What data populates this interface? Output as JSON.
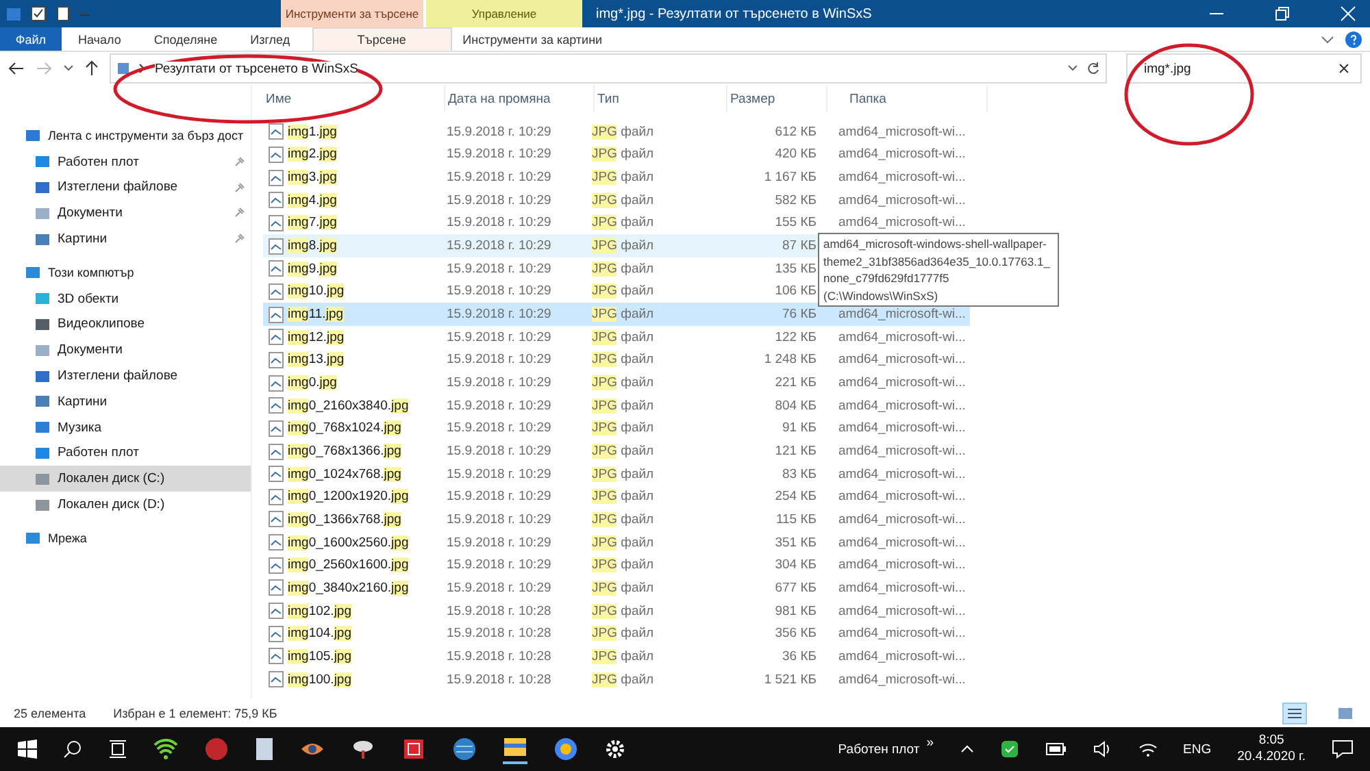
{
  "window": {
    "title": "img*.jpg - Резултати от търсенето в WinSxS",
    "context_groups": [
      {
        "label": "Инструменти за търсене",
        "kind": "search"
      },
      {
        "label": "Управление",
        "kind": "manage"
      }
    ]
  },
  "ribbon_tabs": [
    {
      "label": "Файл",
      "kind": "file",
      "selected": false
    },
    {
      "label": "Начало",
      "kind": "plain",
      "selected": false
    },
    {
      "label": "Споделяне",
      "kind": "plain",
      "selected": false
    },
    {
      "label": "Изглед",
      "kind": "plain",
      "selected": false
    },
    {
      "label": "Търсене",
      "kind": "search",
      "selected": true
    },
    {
      "label": "Инструменти за картини",
      "kind": "manage",
      "selected": false
    }
  ],
  "address": {
    "path": "Резултати от търсенето в WinSxS",
    "search_value": "img*.jpg"
  },
  "sidebar": [
    {
      "label": "Лента с инструменти за бърз дост",
      "selected": false,
      "children": [
        {
          "label": "Работен плот",
          "pinned": true,
          "selected": false
        },
        {
          "label": "Изтеглени файлове",
          "pinned": true,
          "selected": false
        },
        {
          "label": "Документи",
          "pinned": true,
          "selected": false
        },
        {
          "label": "Картини",
          "pinned": true,
          "selected": false
        }
      ]
    },
    {
      "label": "Този компютър",
      "selected": false,
      "children": [
        {
          "label": "3D обекти",
          "pinned": false,
          "selected": false
        },
        {
          "label": "Видеоклипове",
          "pinned": false,
          "selected": false
        },
        {
          "label": "Документи",
          "pinned": false,
          "selected": false
        },
        {
          "label": "Изтеглени файлове",
          "pinned": false,
          "selected": false
        },
        {
          "label": "Картини",
          "pinned": false,
          "selected": false
        },
        {
          "label": "Музика",
          "pinned": false,
          "selected": false
        },
        {
          "label": "Работен плот",
          "pinned": false,
          "selected": false
        },
        {
          "label": "Локален диск (C:)",
          "pinned": false,
          "selected": true
        },
        {
          "label": "Локален диск (D:)",
          "pinned": false,
          "selected": false
        }
      ]
    },
    {
      "label": "Мрежа",
      "selected": false
    }
  ],
  "table": {
    "columns": [
      "Име",
      "Дата на промяна",
      "Тип",
      "Размер",
      "Папка"
    ],
    "rows": [
      {
        "name": [
          {
            "text": "img",
            "hl": true
          },
          {
            "text": "1.",
            "hl": false
          },
          {
            "text": "jpg",
            "hl": true
          }
        ],
        "date": "15.9.2018 г. 10:29",
        "type": [
          {
            "text": "JPG",
            "hl": true
          },
          {
            "text": " файл",
            "hl": false
          }
        ],
        "size": "612 КБ",
        "folder": "amd64_microsoft-wi...",
        "hovered": false,
        "selected": false
      },
      {
        "name": [
          {
            "text": "img",
            "hl": true
          },
          {
            "text": "2.",
            "hl": false
          },
          {
            "text": "jpg",
            "hl": true
          }
        ],
        "date": "15.9.2018 г. 10:29",
        "type": [
          {
            "text": "JPG",
            "hl": true
          },
          {
            "text": " файл",
            "hl": false
          }
        ],
        "size": "420 КБ",
        "folder": "amd64_microsoft-wi...",
        "hovered": false,
        "selected": false
      },
      {
        "name": [
          {
            "text": "img",
            "hl": true
          },
          {
            "text": "3.",
            "hl": false
          },
          {
            "text": "jpg",
            "hl": true
          }
        ],
        "date": "15.9.2018 г. 10:29",
        "type": [
          {
            "text": "JPG",
            "hl": true
          },
          {
            "text": " файл",
            "hl": false
          }
        ],
        "size": "1 167 КБ",
        "folder": "amd64_microsoft-wi...",
        "hovered": false,
        "selected": false
      },
      {
        "name": [
          {
            "text": "img",
            "hl": true
          },
          {
            "text": "4.",
            "hl": false
          },
          {
            "text": "jpg",
            "hl": true
          }
        ],
        "date": "15.9.2018 г. 10:29",
        "type": [
          {
            "text": "JPG",
            "hl": true
          },
          {
            "text": " файл",
            "hl": false
          }
        ],
        "size": "582 КБ",
        "folder": "amd64_microsoft-wi...",
        "hovered": false,
        "selected": false
      },
      {
        "name": [
          {
            "text": "img",
            "hl": true
          },
          {
            "text": "7.",
            "hl": false
          },
          {
            "text": "jpg",
            "hl": true
          }
        ],
        "date": "15.9.2018 г. 10:29",
        "type": [
          {
            "text": "JPG",
            "hl": true
          },
          {
            "text": " файл",
            "hl": false
          }
        ],
        "size": "155 КБ",
        "folder": "amd64_microsoft-wi...",
        "hovered": false,
        "selected": false
      },
      {
        "name": [
          {
            "text": "img",
            "hl": true
          },
          {
            "text": "8.",
            "hl": false
          },
          {
            "text": "jpg",
            "hl": true
          }
        ],
        "date": "15.9.2018 г. 10:29",
        "type": [
          {
            "text": "JPG",
            "hl": true
          },
          {
            "text": " файл",
            "hl": false
          }
        ],
        "size": "87 КБ",
        "folder": "",
        "hovered": true,
        "selected": false
      },
      {
        "name": [
          {
            "text": "img",
            "hl": true
          },
          {
            "text": "9.",
            "hl": false
          },
          {
            "text": "jpg",
            "hl": true
          }
        ],
        "date": "15.9.2018 г. 10:29",
        "type": [
          {
            "text": "JPG",
            "hl": true
          },
          {
            "text": " файл",
            "hl": false
          }
        ],
        "size": "135 КБ",
        "folder": "",
        "hovered": false,
        "selected": false
      },
      {
        "name": [
          {
            "text": "img",
            "hl": true
          },
          {
            "text": "10.",
            "hl": false
          },
          {
            "text": "jpg",
            "hl": true
          }
        ],
        "date": "15.9.2018 г. 10:29",
        "type": [
          {
            "text": "JPG",
            "hl": true
          },
          {
            "text": " файл",
            "hl": false
          }
        ],
        "size": "106 КБ",
        "folder": "",
        "hovered": false,
        "selected": false
      },
      {
        "name": [
          {
            "text": "img",
            "hl": true
          },
          {
            "text": "11.",
            "hl": false
          },
          {
            "text": "jpg",
            "hl": true
          }
        ],
        "date": "15.9.2018 г. 10:29",
        "type": [
          {
            "text": "JPG",
            "hl": true
          },
          {
            "text": " файл",
            "hl": false
          }
        ],
        "size": "76 КБ",
        "folder": "amd64_microsoft-wi...",
        "hovered": false,
        "selected": true
      },
      {
        "name": [
          {
            "text": "img",
            "hl": true
          },
          {
            "text": "12.",
            "hl": false
          },
          {
            "text": "jpg",
            "hl": true
          }
        ],
        "date": "15.9.2018 г. 10:29",
        "type": [
          {
            "text": "JPG",
            "hl": true
          },
          {
            "text": " файл",
            "hl": false
          }
        ],
        "size": "122 КБ",
        "folder": "amd64_microsoft-wi...",
        "hovered": false,
        "selected": false
      },
      {
        "name": [
          {
            "text": "img",
            "hl": true
          },
          {
            "text": "13.",
            "hl": false
          },
          {
            "text": "jpg",
            "hl": true
          }
        ],
        "date": "15.9.2018 г. 10:29",
        "type": [
          {
            "text": "JPG",
            "hl": true
          },
          {
            "text": " файл",
            "hl": false
          }
        ],
        "size": "1 248 КБ",
        "folder": "amd64_microsoft-wi...",
        "hovered": false,
        "selected": false
      },
      {
        "name": [
          {
            "text": "img",
            "hl": true
          },
          {
            "text": "0.",
            "hl": false
          },
          {
            "text": "jpg",
            "hl": true
          }
        ],
        "date": "15.9.2018 г. 10:29",
        "type": [
          {
            "text": "JPG",
            "hl": true
          },
          {
            "text": " файл",
            "hl": false
          }
        ],
        "size": "221 КБ",
        "folder": "amd64_microsoft-wi...",
        "hovered": false,
        "selected": false
      },
      {
        "name": [
          {
            "text": "img",
            "hl": true
          },
          {
            "text": "0_2160x3840.",
            "hl": false
          },
          {
            "text": "jpg",
            "hl": true
          }
        ],
        "date": "15.9.2018 г. 10:29",
        "type": [
          {
            "text": "JPG",
            "hl": true
          },
          {
            "text": " файл",
            "hl": false
          }
        ],
        "size": "804 КБ",
        "folder": "amd64_microsoft-wi...",
        "hovered": false,
        "selected": false
      },
      {
        "name": [
          {
            "text": "img",
            "hl": true
          },
          {
            "text": "0_768x1024.",
            "hl": false
          },
          {
            "text": "jpg",
            "hl": true
          }
        ],
        "date": "15.9.2018 г. 10:29",
        "type": [
          {
            "text": "JPG",
            "hl": true
          },
          {
            "text": " файл",
            "hl": false
          }
        ],
        "size": "91 КБ",
        "folder": "amd64_microsoft-wi...",
        "hovered": false,
        "selected": false
      },
      {
        "name": [
          {
            "text": "img",
            "hl": true
          },
          {
            "text": "0_768x1366.",
            "hl": false
          },
          {
            "text": "jpg",
            "hl": true
          }
        ],
        "date": "15.9.2018 г. 10:29",
        "type": [
          {
            "text": "JPG",
            "hl": true
          },
          {
            "text": " файл",
            "hl": false
          }
        ],
        "size": "121 КБ",
        "folder": "amd64_microsoft-wi...",
        "hovered": false,
        "selected": false
      },
      {
        "name": [
          {
            "text": "img",
            "hl": true
          },
          {
            "text": "0_1024x768.",
            "hl": false
          },
          {
            "text": "jpg",
            "hl": true
          }
        ],
        "date": "15.9.2018 г. 10:29",
        "type": [
          {
            "text": "JPG",
            "hl": true
          },
          {
            "text": " файл",
            "hl": false
          }
        ],
        "size": "83 КБ",
        "folder": "amd64_microsoft-wi...",
        "hovered": false,
        "selected": false
      },
      {
        "name": [
          {
            "text": "img",
            "hl": true
          },
          {
            "text": "0_1200x1920.",
            "hl": false
          },
          {
            "text": "jpg",
            "hl": true
          }
        ],
        "date": "15.9.2018 г. 10:29",
        "type": [
          {
            "text": "JPG",
            "hl": true
          },
          {
            "text": " файл",
            "hl": false
          }
        ],
        "size": "254 КБ",
        "folder": "amd64_microsoft-wi...",
        "hovered": false,
        "selected": false
      },
      {
        "name": [
          {
            "text": "img",
            "hl": true
          },
          {
            "text": "0_1366x768.",
            "hl": false
          },
          {
            "text": "jpg",
            "hl": true
          }
        ],
        "date": "15.9.2018 г. 10:29",
        "type": [
          {
            "text": "JPG",
            "hl": true
          },
          {
            "text": " файл",
            "hl": false
          }
        ],
        "size": "115 КБ",
        "folder": "amd64_microsoft-wi...",
        "hovered": false,
        "selected": false
      },
      {
        "name": [
          {
            "text": "img",
            "hl": true
          },
          {
            "text": "0_1600x2560.",
            "hl": false
          },
          {
            "text": "jpg",
            "hl": true
          }
        ],
        "date": "15.9.2018 г. 10:29",
        "type": [
          {
            "text": "JPG",
            "hl": true
          },
          {
            "text": " файл",
            "hl": false
          }
        ],
        "size": "351 КБ",
        "folder": "amd64_microsoft-wi...",
        "hovered": false,
        "selected": false
      },
      {
        "name": [
          {
            "text": "img",
            "hl": true
          },
          {
            "text": "0_2560x1600.",
            "hl": false
          },
          {
            "text": "jpg",
            "hl": true
          }
        ],
        "date": "15.9.2018 г. 10:29",
        "type": [
          {
            "text": "JPG",
            "hl": true
          },
          {
            "text": " файл",
            "hl": false
          }
        ],
        "size": "304 КБ",
        "folder": "amd64_microsoft-wi...",
        "hovered": false,
        "selected": false
      },
      {
        "name": [
          {
            "text": "img",
            "hl": true
          },
          {
            "text": "0_3840x2160.",
            "hl": false
          },
          {
            "text": "jpg",
            "hl": true
          }
        ],
        "date": "15.9.2018 г. 10:29",
        "type": [
          {
            "text": "JPG",
            "hl": true
          },
          {
            "text": " файл",
            "hl": false
          }
        ],
        "size": "677 КБ",
        "folder": "amd64_microsoft-wi...",
        "hovered": false,
        "selected": false
      },
      {
        "name": [
          {
            "text": "img",
            "hl": true
          },
          {
            "text": "102.",
            "hl": false
          },
          {
            "text": "jpg",
            "hl": true
          }
        ],
        "date": "15.9.2018 г. 10:28",
        "type": [
          {
            "text": "JPG",
            "hl": true
          },
          {
            "text": " файл",
            "hl": false
          }
        ],
        "size": "981 КБ",
        "folder": "amd64_microsoft-wi...",
        "hovered": false,
        "selected": false
      },
      {
        "name": [
          {
            "text": "img",
            "hl": true
          },
          {
            "text": "104.",
            "hl": false
          },
          {
            "text": "jpg",
            "hl": true
          }
        ],
        "date": "15.9.2018 г. 10:28",
        "type": [
          {
            "text": "JPG",
            "hl": true
          },
          {
            "text": " файл",
            "hl": false
          }
        ],
        "size": "356 КБ",
        "folder": "amd64_microsoft-wi...",
        "hovered": false,
        "selected": false
      },
      {
        "name": [
          {
            "text": "img",
            "hl": true
          },
          {
            "text": "105.",
            "hl": false
          },
          {
            "text": "jpg",
            "hl": true
          }
        ],
        "date": "15.9.2018 г. 10:28",
        "type": [
          {
            "text": "JPG",
            "hl": true
          },
          {
            "text": " файл",
            "hl": false
          }
        ],
        "size": "36 КБ",
        "folder": "amd64_microsoft-wi...",
        "hovered": false,
        "selected": false
      },
      {
        "name": [
          {
            "text": "img",
            "hl": true
          },
          {
            "text": "100.",
            "hl": false
          },
          {
            "text": "jpg",
            "hl": true
          }
        ],
        "date": "15.9.2018 г. 10:28",
        "type": [
          {
            "text": "JPG",
            "hl": true
          },
          {
            "text": " файл",
            "hl": false
          }
        ],
        "size": "1 521 КБ",
        "folder": "amd64_microsoft-wi...",
        "hovered": false,
        "selected": false
      }
    ]
  },
  "tooltip": "amd64_microsoft-windows-shell-wallpaper-theme2_31bf3856ad364e35_10.0.17763.1_none_c79fd629fd1777f5 (C:\\Windows\\WinSxS)",
  "status_bar": {
    "count": "25 елемента",
    "selection": "Избран е 1 елемент: 75,9 КБ"
  },
  "taskbar": {
    "toolbar_label": "Работен плот",
    "chevron": "»",
    "language": "ENG",
    "time": "8:05",
    "date": "20.4.2020 г."
  }
}
